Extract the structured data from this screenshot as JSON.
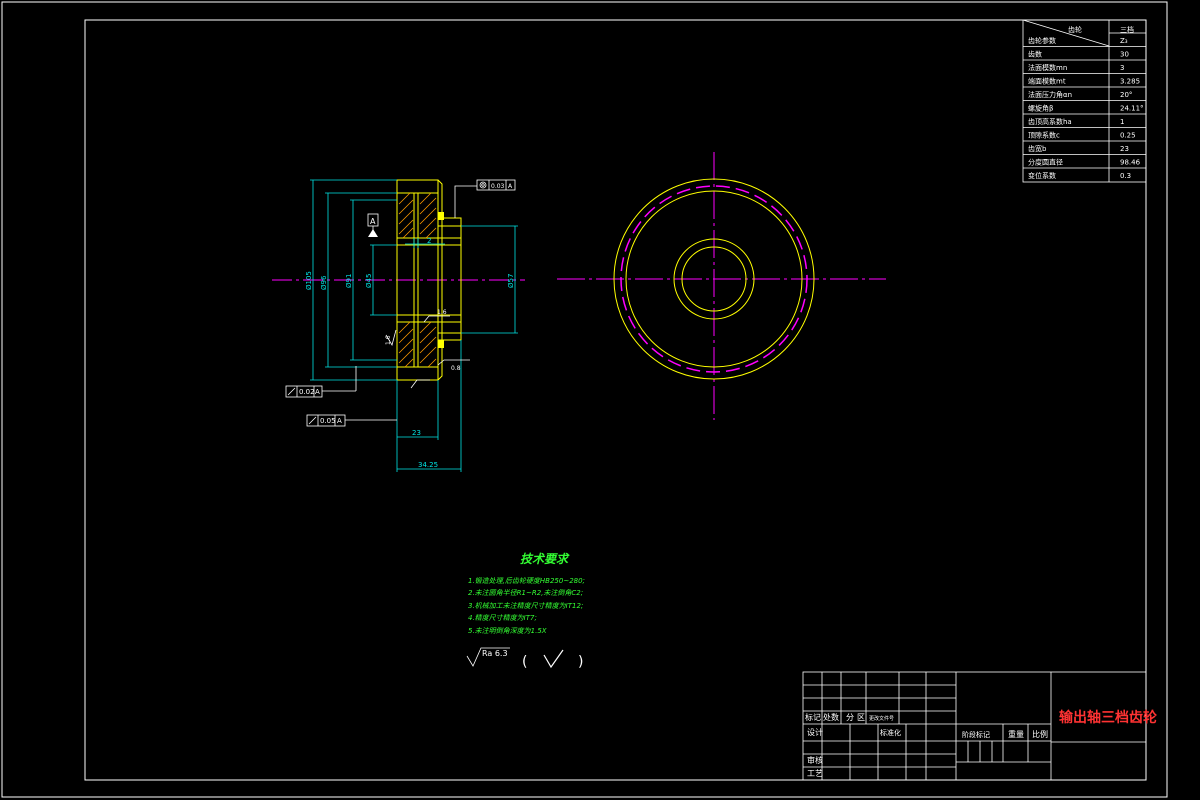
{
  "drawing": {
    "title": "输出轴三档齿轮"
  },
  "parameter_table": {
    "header_right": "三档",
    "rows": [
      {
        "label": "齿轮参数",
        "value": "Z₃"
      },
      {
        "label": "齿数",
        "value": "30"
      },
      {
        "label": "法面模数mn",
        "value": "3"
      },
      {
        "label": "端面模数mt",
        "value": "3.285"
      },
      {
        "label": "法面压力角αn",
        "value": "20°"
      },
      {
        "label": "螺旋角β",
        "value": "24.11°"
      },
      {
        "label": "齿顶高系数ha",
        "value": "1"
      },
      {
        "label": "顶隙系数c",
        "value": "0.25"
      },
      {
        "label": "齿宽b",
        "value": "23"
      },
      {
        "label": "分度圆直径",
        "value": "98.46"
      },
      {
        "label": "变位系数",
        "value": "0.3"
      }
    ],
    "header_left": "齿轮"
  },
  "dimensions": {
    "d_outer": "Ø105",
    "d_96": "Ø96",
    "d_91": "Ø91",
    "d_45": "Ø45",
    "d_57": "Ø57",
    "w_2": "2",
    "w_23": "23",
    "w_total": "34.25",
    "tol_runout_1": "0.02",
    "tol_runout_2": "0.05",
    "tol_coaxial": "0.03",
    "datum": "A",
    "rough_1": "1.6",
    "rough_2": "0.8",
    "rough_3": "1.6"
  },
  "tech": {
    "title": "技术要求",
    "lines": [
      "1.锻造处理,后齿轮硬度HB250~280;",
      "2.未注圆角半径R1~R2,未注倒角C2;",
      "3.机械加工未注精度尺寸精度为IT12;",
      "4.精度尺寸精度为IT7;",
      "5.未注明倒角深度为1.5X"
    ],
    "roughness_value": "Ra 6.3",
    "paren_open": "(",
    "paren_close": ")"
  },
  "title_block": {
    "mark": "标记",
    "count": "处数",
    "zone": "分",
    "zone2": "区",
    "change_doc": "更改文件号",
    "design": "设计",
    "standardize": "标准化",
    "review": "审核",
    "process": "工艺",
    "stage_mark": "阶段标记",
    "weight": "重量",
    "scale": "比例"
  },
  "colors": {
    "outline": "#ffffff",
    "part": "#ffff00",
    "center": "#ff00ff",
    "dim": "#00e5e5",
    "hatch": "#ff9900",
    "text_green": "#33ff33",
    "title_red": "#ff3333"
  }
}
